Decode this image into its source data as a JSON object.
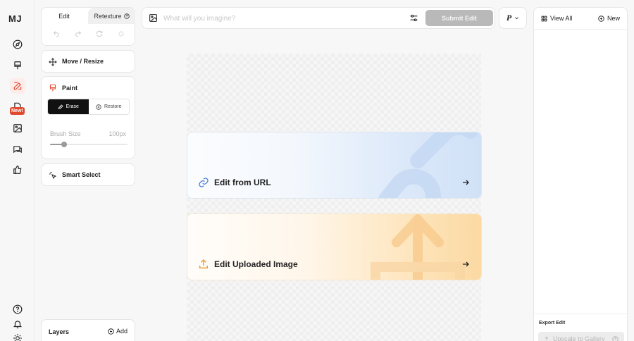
{
  "app": {
    "logo": "MJ"
  },
  "sidebar": {
    "items": [
      {
        "name": "explore",
        "icon": "compass-icon"
      },
      {
        "name": "create",
        "icon": "brush-icon"
      },
      {
        "name": "edit",
        "icon": "edit-icon",
        "active": true
      },
      {
        "name": "personalize",
        "icon": "book-icon",
        "badge": "New!"
      },
      {
        "name": "organize",
        "icon": "image-icon"
      },
      {
        "name": "chat",
        "icon": "chat-icon"
      },
      {
        "name": "rank",
        "icon": "thumbs-up-icon"
      }
    ],
    "bottom": [
      {
        "name": "help",
        "icon": "help-icon"
      },
      {
        "name": "notifications",
        "icon": "bell-icon"
      },
      {
        "name": "theme",
        "icon": "sun-icon"
      }
    ]
  },
  "tools": {
    "tabs": [
      {
        "label": "Edit",
        "active": true
      },
      {
        "label": "Retexture"
      }
    ],
    "move_label": "Move / Resize",
    "paint": {
      "label": "Paint",
      "erase_label": "Erase",
      "restore_label": "Restore",
      "selected_mode": "Erase",
      "brush_label": "Brush Size",
      "brush_value": "100px",
      "brush_fraction": 0.18
    },
    "smart_select_label": "Smart Select",
    "layers": {
      "label": "Layers",
      "add_label": "Add"
    }
  },
  "prompt": {
    "placeholder": "What will you imagine?",
    "value": "",
    "submit_label": "Submit Edit",
    "param_glyph": "P"
  },
  "canvas": {
    "url_card": {
      "label": "Edit from URL"
    },
    "upload_card": {
      "label": "Edit Uploaded Image"
    }
  },
  "right_panel": {
    "view_all_label": "View All",
    "new_label": "New",
    "export_label": "Export Edit",
    "upscale_label": "Upscale to Gallery"
  },
  "colors": {
    "accent": "#e04a2f",
    "submit_disabled": "#b9b9b9",
    "url_gradient": "#d0e1f7",
    "upload_gradient": "#fcd9a3"
  }
}
